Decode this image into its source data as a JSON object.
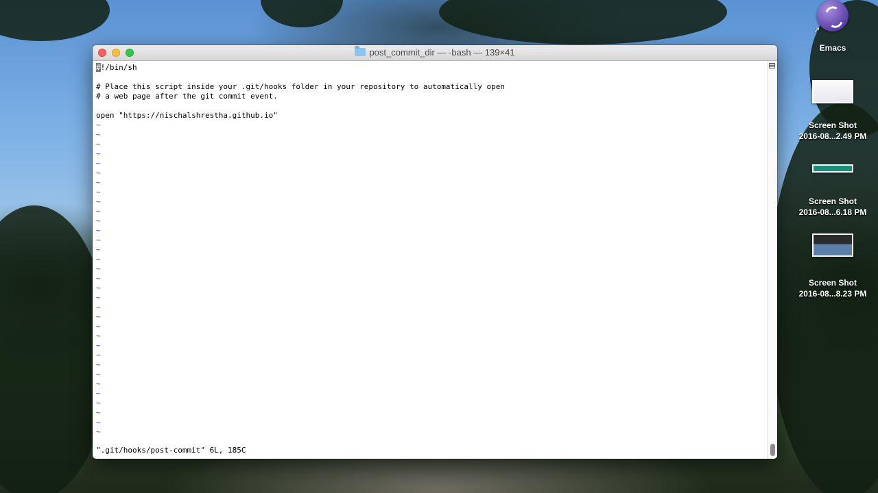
{
  "window": {
    "title": "post_commit_dir — -bash — 139×41"
  },
  "editor": {
    "cursor_char": "#",
    "lines": [
      "!/bin/sh",
      "",
      "# Place this script inside your .git/hooks folder in your repository to automatically open",
      "# a web page after the git commit event.",
      "",
      "open \"https://nischalshrestha.github.io\""
    ],
    "empty_line_marker": "~",
    "empty_line_count": 33,
    "status": "\".git/hooks/post-commit\" 6L, 185C"
  },
  "desktop_icons": [
    {
      "label": "Emacs",
      "icon": "emacs-icon"
    },
    {
      "label_line1": "Screen Shot",
      "label_line2": "2016-08...2.49 PM",
      "icon": "screenshot-thumbnail-icon"
    },
    {
      "label_line1": "Screen Shot",
      "label_line2": "2016-08...6.18 PM",
      "icon": "screenshot-thumbnail-icon"
    },
    {
      "label_line1": "Screen Shot",
      "label_line2": "2016-08...8.23 PM",
      "icon": "screenshot-thumbnail-icon"
    }
  ],
  "colors": {
    "tilde": "#3b3bd6",
    "close": "#fc605c",
    "minimize": "#fdbc40",
    "maximize": "#34c84a"
  }
}
